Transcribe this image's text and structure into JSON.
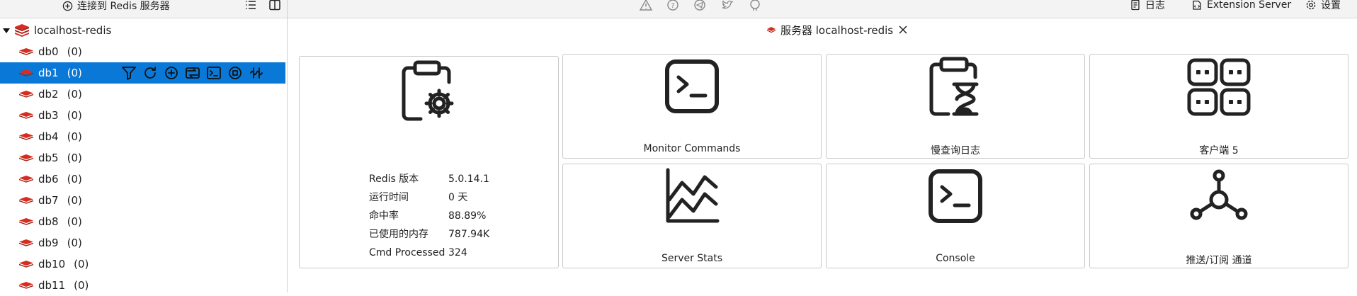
{
  "left_toolbar": {
    "connect_label": "连接到 Redis 服务器"
  },
  "tree": {
    "connection": "localhost-redis",
    "databases": [
      {
        "name": "db0",
        "count": "(0)"
      },
      {
        "name": "db1",
        "count": "(0)"
      },
      {
        "name": "db2",
        "count": "(0)"
      },
      {
        "name": "db3",
        "count": "(0)"
      },
      {
        "name": "db4",
        "count": "(0)"
      },
      {
        "name": "db5",
        "count": "(0)"
      },
      {
        "name": "db6",
        "count": "(0)"
      },
      {
        "name": "db7",
        "count": "(0)"
      },
      {
        "name": "db8",
        "count": "(0)"
      },
      {
        "name": "db9",
        "count": "(0)"
      },
      {
        "name": "db10",
        "count": "(0)"
      },
      {
        "name": "db11",
        "count": "(0)"
      }
    ],
    "selected_index": 1
  },
  "topbar": {
    "log_label": "日志",
    "extension_label": "Extension Server",
    "settings_label": "设置"
  },
  "tab": {
    "title": "服务器 localhost-redis"
  },
  "server_info": {
    "rows": [
      {
        "key": "Redis 版本",
        "value": "5.0.14.1"
      },
      {
        "key": "运行时间",
        "value": "0 天"
      },
      {
        "key": "命中率",
        "value": "88.89%"
      },
      {
        "key": "已使用的内存",
        "value": "787.94K"
      },
      {
        "key": "Cmd Processed",
        "value": "324"
      }
    ]
  },
  "cards": {
    "monitor": "Monitor Commands",
    "slowlog": "慢查询日志",
    "clients": "客户端 5",
    "stats": "Server Stats",
    "console": "Console",
    "pubsub": "推送/订阅 通道"
  },
  "colors": {
    "accent": "#0a78d7",
    "redis_red": "#d82c20",
    "icon_dark": "#222222"
  }
}
